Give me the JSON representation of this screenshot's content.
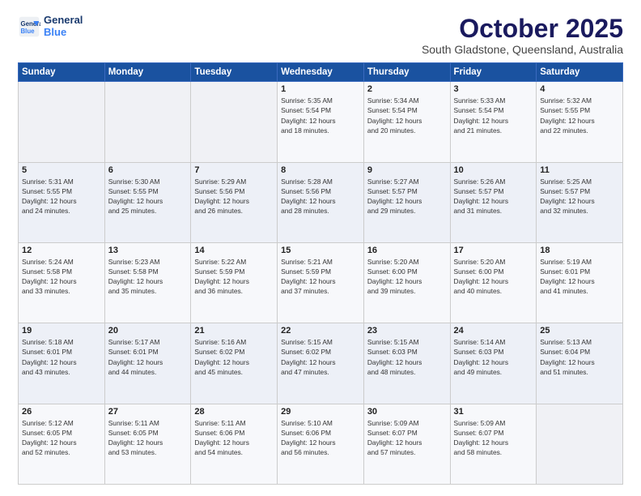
{
  "header": {
    "logo_line1": "General",
    "logo_line2": "Blue",
    "month": "October 2025",
    "location": "South Gladstone, Queensland, Australia"
  },
  "days_of_week": [
    "Sunday",
    "Monday",
    "Tuesday",
    "Wednesday",
    "Thursday",
    "Friday",
    "Saturday"
  ],
  "weeks": [
    [
      {
        "day": "",
        "info": ""
      },
      {
        "day": "",
        "info": ""
      },
      {
        "day": "",
        "info": ""
      },
      {
        "day": "1",
        "info": "Sunrise: 5:35 AM\nSunset: 5:54 PM\nDaylight: 12 hours\nand 18 minutes."
      },
      {
        "day": "2",
        "info": "Sunrise: 5:34 AM\nSunset: 5:54 PM\nDaylight: 12 hours\nand 20 minutes."
      },
      {
        "day": "3",
        "info": "Sunrise: 5:33 AM\nSunset: 5:54 PM\nDaylight: 12 hours\nand 21 minutes."
      },
      {
        "day": "4",
        "info": "Sunrise: 5:32 AM\nSunset: 5:55 PM\nDaylight: 12 hours\nand 22 minutes."
      }
    ],
    [
      {
        "day": "5",
        "info": "Sunrise: 5:31 AM\nSunset: 5:55 PM\nDaylight: 12 hours\nand 24 minutes."
      },
      {
        "day": "6",
        "info": "Sunrise: 5:30 AM\nSunset: 5:55 PM\nDaylight: 12 hours\nand 25 minutes."
      },
      {
        "day": "7",
        "info": "Sunrise: 5:29 AM\nSunset: 5:56 PM\nDaylight: 12 hours\nand 26 minutes."
      },
      {
        "day": "8",
        "info": "Sunrise: 5:28 AM\nSunset: 5:56 PM\nDaylight: 12 hours\nand 28 minutes."
      },
      {
        "day": "9",
        "info": "Sunrise: 5:27 AM\nSunset: 5:57 PM\nDaylight: 12 hours\nand 29 minutes."
      },
      {
        "day": "10",
        "info": "Sunrise: 5:26 AM\nSunset: 5:57 PM\nDaylight: 12 hours\nand 31 minutes."
      },
      {
        "day": "11",
        "info": "Sunrise: 5:25 AM\nSunset: 5:57 PM\nDaylight: 12 hours\nand 32 minutes."
      }
    ],
    [
      {
        "day": "12",
        "info": "Sunrise: 5:24 AM\nSunset: 5:58 PM\nDaylight: 12 hours\nand 33 minutes."
      },
      {
        "day": "13",
        "info": "Sunrise: 5:23 AM\nSunset: 5:58 PM\nDaylight: 12 hours\nand 35 minutes."
      },
      {
        "day": "14",
        "info": "Sunrise: 5:22 AM\nSunset: 5:59 PM\nDaylight: 12 hours\nand 36 minutes."
      },
      {
        "day": "15",
        "info": "Sunrise: 5:21 AM\nSunset: 5:59 PM\nDaylight: 12 hours\nand 37 minutes."
      },
      {
        "day": "16",
        "info": "Sunrise: 5:20 AM\nSunset: 6:00 PM\nDaylight: 12 hours\nand 39 minutes."
      },
      {
        "day": "17",
        "info": "Sunrise: 5:20 AM\nSunset: 6:00 PM\nDaylight: 12 hours\nand 40 minutes."
      },
      {
        "day": "18",
        "info": "Sunrise: 5:19 AM\nSunset: 6:01 PM\nDaylight: 12 hours\nand 41 minutes."
      }
    ],
    [
      {
        "day": "19",
        "info": "Sunrise: 5:18 AM\nSunset: 6:01 PM\nDaylight: 12 hours\nand 43 minutes."
      },
      {
        "day": "20",
        "info": "Sunrise: 5:17 AM\nSunset: 6:01 PM\nDaylight: 12 hours\nand 44 minutes."
      },
      {
        "day": "21",
        "info": "Sunrise: 5:16 AM\nSunset: 6:02 PM\nDaylight: 12 hours\nand 45 minutes."
      },
      {
        "day": "22",
        "info": "Sunrise: 5:15 AM\nSunset: 6:02 PM\nDaylight: 12 hours\nand 47 minutes."
      },
      {
        "day": "23",
        "info": "Sunrise: 5:15 AM\nSunset: 6:03 PM\nDaylight: 12 hours\nand 48 minutes."
      },
      {
        "day": "24",
        "info": "Sunrise: 5:14 AM\nSunset: 6:03 PM\nDaylight: 12 hours\nand 49 minutes."
      },
      {
        "day": "25",
        "info": "Sunrise: 5:13 AM\nSunset: 6:04 PM\nDaylight: 12 hours\nand 51 minutes."
      }
    ],
    [
      {
        "day": "26",
        "info": "Sunrise: 5:12 AM\nSunset: 6:05 PM\nDaylight: 12 hours\nand 52 minutes."
      },
      {
        "day": "27",
        "info": "Sunrise: 5:11 AM\nSunset: 6:05 PM\nDaylight: 12 hours\nand 53 minutes."
      },
      {
        "day": "28",
        "info": "Sunrise: 5:11 AM\nSunset: 6:06 PM\nDaylight: 12 hours\nand 54 minutes."
      },
      {
        "day": "29",
        "info": "Sunrise: 5:10 AM\nSunset: 6:06 PM\nDaylight: 12 hours\nand 56 minutes."
      },
      {
        "day": "30",
        "info": "Sunrise: 5:09 AM\nSunset: 6:07 PM\nDaylight: 12 hours\nand 57 minutes."
      },
      {
        "day": "31",
        "info": "Sunrise: 5:09 AM\nSunset: 6:07 PM\nDaylight: 12 hours\nand 58 minutes."
      },
      {
        "day": "",
        "info": ""
      }
    ]
  ]
}
